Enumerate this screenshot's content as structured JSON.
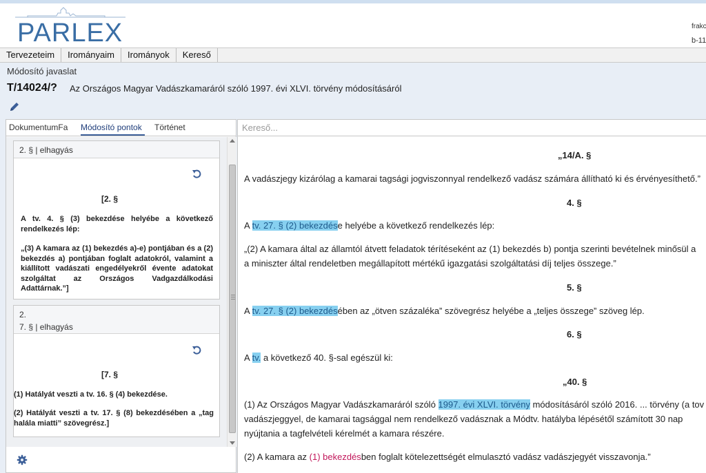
{
  "app": {
    "logo_text": "PARLEX",
    "user_line1": "frakc",
    "user_line2": "b-11"
  },
  "menu": [
    {
      "label": "Tervezeteim"
    },
    {
      "label": "Irományaim"
    },
    {
      "label": "Irományok"
    },
    {
      "label": "Kereső"
    }
  ],
  "page": {
    "kind": "Módosító javaslat",
    "bill_id": "T/14024/?",
    "bill_title": "Az Országos Magyar Vadászkamaráról szóló 1997. évi XLVI. törvény módosításáról"
  },
  "left": {
    "tabs": [
      {
        "label": "DokumentumFa",
        "active": false
      },
      {
        "label": "Módosító pontok",
        "active": true
      },
      {
        "label": "Történet",
        "active": false
      }
    ],
    "cards": [
      {
        "head": "2. § | elhagyás",
        "heading": "[2. §",
        "intro": "A tv. 4. § (3) bekezdése helyébe a következő rendelkezés lép:",
        "body": "„(3) A kamara az (1) bekezdés a)-e) pontjában és a (2) bekezdés a) pontjában foglalt adatokról, valamint a kiállított vadászati engedélyekről évente adatokat szolgáltat az Országos Vadgazdálkodási Adattárnak.”]"
      },
      {
        "num": "2.",
        "head": "7. § | elhagyás",
        "heading": "[7. §",
        "line1": "(1) Hatályát veszti a tv. 16. § (4) bekezdése.",
        "line2": "(2) Hatályát veszti a tv. 17. § (8) bekezdésében a „tag halála miatti” szövegrész.]"
      }
    ]
  },
  "right": {
    "search_placeholder": "Kereső...",
    "doc": {
      "h1": "„14/A. §",
      "p1": "A vadászjegy kizárólag a kamarai tagsági jogviszonnyal rendelkező vadász számára állítható ki és érvényesíthető.”",
      "h2": "4. §",
      "p2_pre": "A ",
      "p2_hl": "tv. 27. § (2) bekezdés",
      "p2_post": "e helyébe a következő rendelkezés lép:",
      "p3a": "„(2) A kamara által az államtól átvett feladatok térítéseként az (1) bekezdés b) pontja szerinti bevételnek minősül a",
      "p3b": "a miniszter által rendeletben megállapított mértékű igazgatási szolgáltatási díj teljes összege.”",
      "h3": "5. §",
      "p4_pre": "A ",
      "p4_hl": "tv. 27. § (2) bekezdés",
      "p4_post": "ében az „ötven százaléka” szövegrész helyébe a „teljes összege” szöveg lép.",
      "h4": "6. §",
      "p5_pre": "A ",
      "p5_hl": "tv.",
      "p5_post": " a következő 40. §-sal egészül ki:",
      "h5": "„40. §",
      "p6_pre": "(1) Az Országos Magyar Vadászkamaráról szóló ",
      "p6_hl": "1997. évi XLVI. törvény",
      "p6_post": " módosításáról szóló 2016. ... törvény (a tov",
      "p6b": "vadászjeggyel, de kamarai tagsággal nem rendelkező vadásznak a Módtv. hatályba lépésétől számított 30 nap",
      "p6c": "nyújtania a tagfelvételi kérelmét a kamara részére.",
      "p7_pre": "(2) A kamara az ",
      "p7_red": "(1) bekezdés",
      "p7_post": "ben foglalt kötelezettségét elmulasztó vadász vadászjegyét visszavonja.”"
    }
  },
  "colors": {
    "accent": "#3c5f99",
    "highlight": "#87d0f0",
    "reference_red": "#c2185b",
    "background": "#e8eef6"
  },
  "icons": [
    "edit-icon",
    "undo-icon",
    "gear-icon"
  ]
}
